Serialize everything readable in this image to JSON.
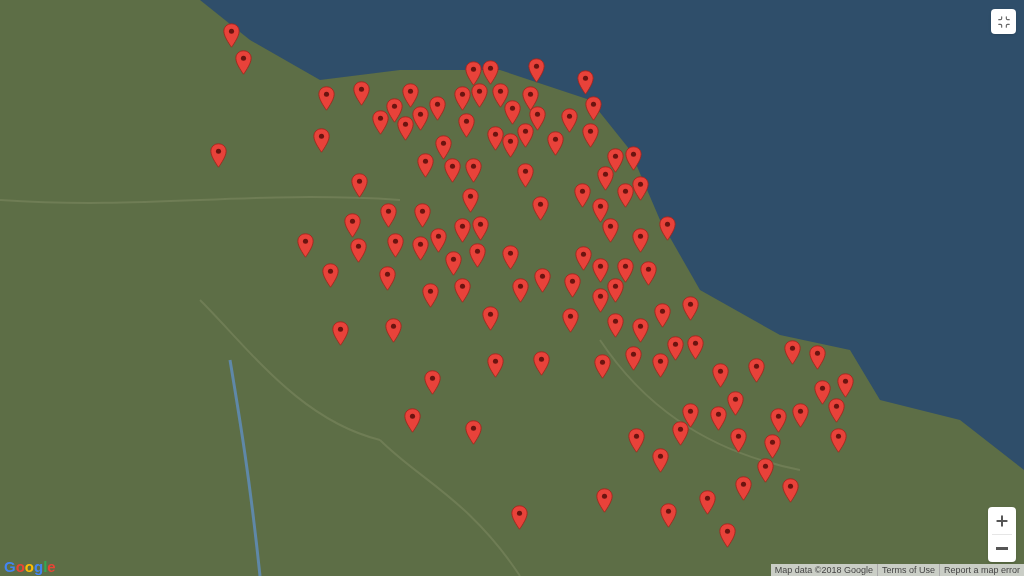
{
  "logo": "Google",
  "attribution": {
    "map_data": "Map data ©2018 Google",
    "links": [
      "Terms of Use",
      "Report a map error"
    ]
  }
}
